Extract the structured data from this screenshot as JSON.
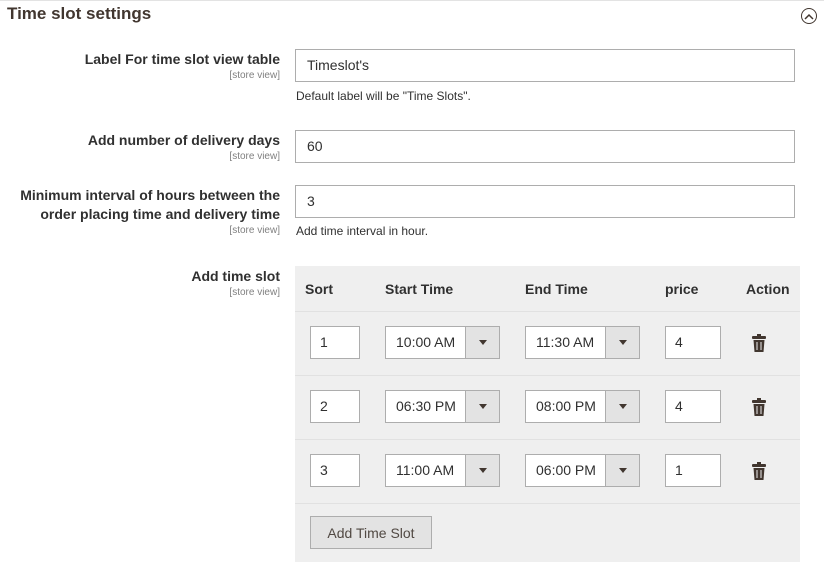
{
  "section": {
    "title": "Time slot settings"
  },
  "fields": {
    "label": {
      "label": "Label For time slot view table",
      "scope": "[store view]",
      "value": "Timeslot's",
      "note": "Default label will be \"Time Slots\"."
    },
    "days": {
      "label": "Add number of delivery days",
      "scope": "[store view]",
      "value": "60"
    },
    "interval": {
      "label_line1": "Minimum interval of hours between the",
      "label_line2": "order placing time and delivery time",
      "scope": "[store view]",
      "value": "3",
      "note": "Add time interval in hour."
    },
    "slots": {
      "label": "Add time slot",
      "scope": "[store view]"
    }
  },
  "grid": {
    "headers": {
      "sort": "Sort",
      "start": "Start Time",
      "end": "End Time",
      "price": "price",
      "action": "Action"
    },
    "rows": [
      {
        "sort": "1",
        "start": "10:00 AM",
        "end": "11:30 AM",
        "price": "4"
      },
      {
        "sort": "2",
        "start": "06:30 PM",
        "end": "08:00 PM",
        "price": "4"
      },
      {
        "sort": "3",
        "start": "11:00 AM",
        "end": "06:00 PM",
        "price": "1"
      }
    ],
    "add_button": "Add Time Slot"
  },
  "icons": {
    "collapse": "chevron-up-circle-icon",
    "delete": "trash-icon"
  }
}
